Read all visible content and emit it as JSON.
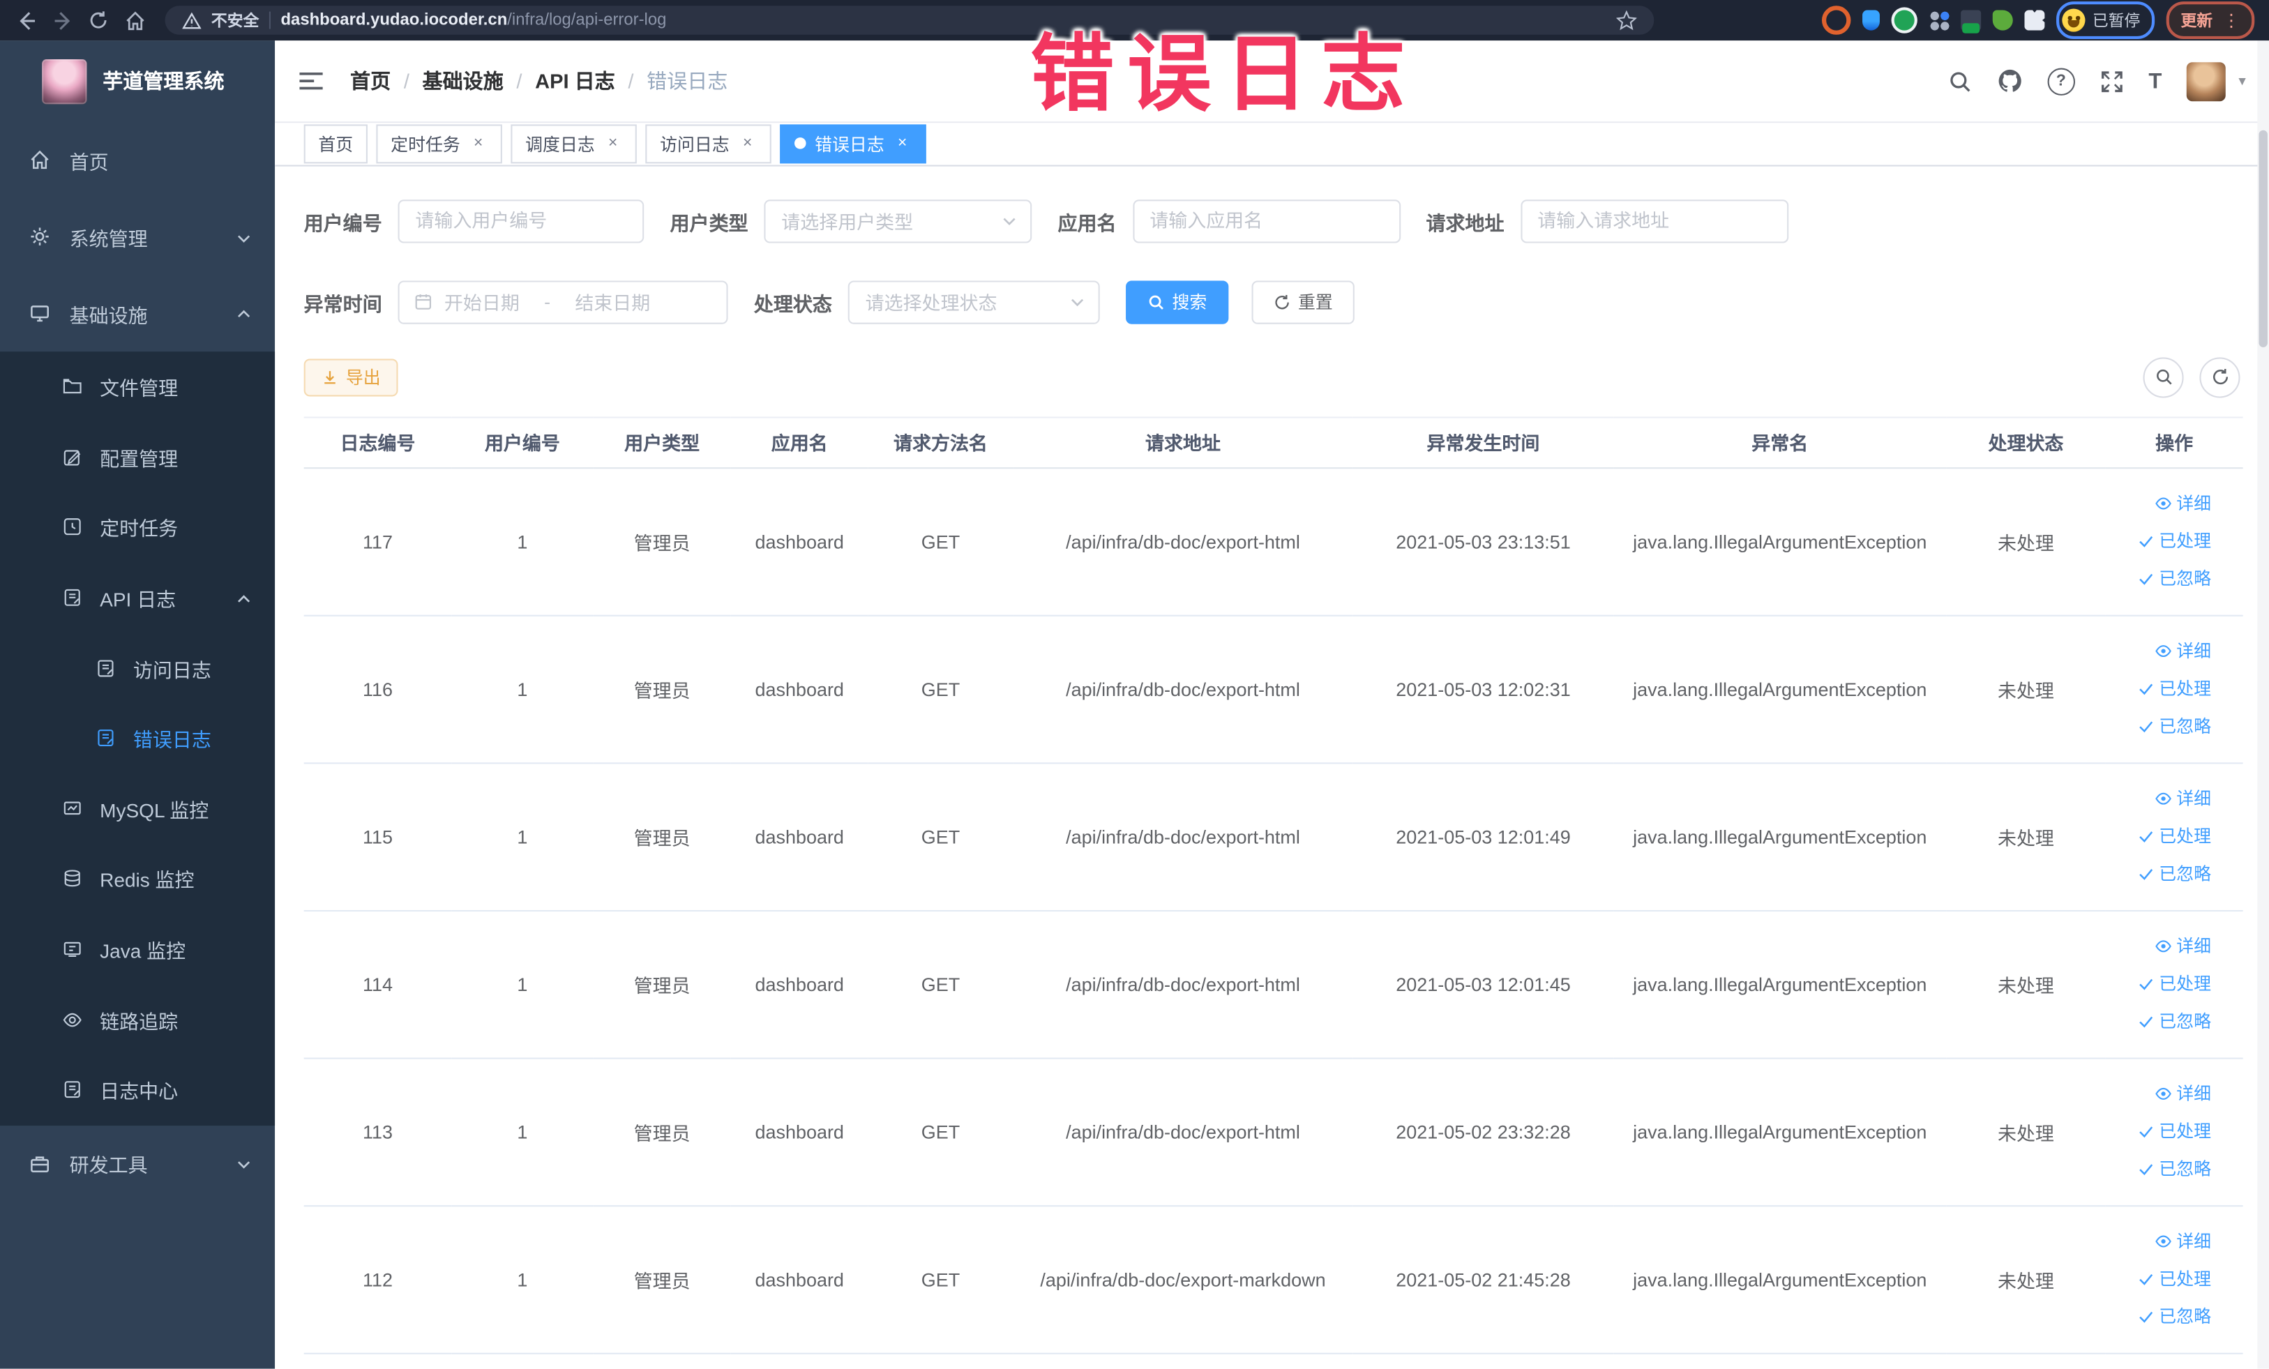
{
  "colors": {
    "accent": "#409eff",
    "warning_button": "#e6a23c",
    "annotation_red": "#f2365f",
    "sidebar_bg": "#304156",
    "submenu_bg": "#1f2d3d"
  },
  "annotation": {
    "text": "错误日志"
  },
  "browser": {
    "security_label": "不安全",
    "url_domain": "dashboard.yudao.iocoder.cn",
    "url_path": "/infra/log/api-error-log",
    "paused_badge": "已暂停",
    "update_button": "更新"
  },
  "icons": {
    "close": "×",
    "caret_down": "▾",
    "kebab": "⋮",
    "breadcrumb_sep": "/",
    "question": "?",
    "text_size": "T"
  },
  "sidebar": {
    "app_title": "芋道管理系统",
    "items": [
      {
        "label": "首页"
      },
      {
        "label": "系统管理"
      },
      {
        "label": "基础设施"
      },
      {
        "label": "文件管理"
      },
      {
        "label": "配置管理"
      },
      {
        "label": "定时任务"
      },
      {
        "label": "API 日志"
      },
      {
        "label": "访问日志"
      },
      {
        "label": "错误日志"
      },
      {
        "label": "MySQL 监控"
      },
      {
        "label": "Redis 监控"
      },
      {
        "label": "Java 监控"
      },
      {
        "label": "链路追踪"
      },
      {
        "label": "日志中心"
      },
      {
        "label": "研发工具"
      }
    ]
  },
  "breadcrumb": {
    "items": [
      "首页",
      "基础设施",
      "API 日志",
      "错误日志"
    ]
  },
  "tabs": [
    {
      "label": "首页"
    },
    {
      "label": "定时任务"
    },
    {
      "label": "调度日志"
    },
    {
      "label": "访问日志"
    },
    {
      "label": "错误日志"
    }
  ],
  "filters": {
    "user_id_label": "用户编号",
    "user_id_placeholder": "请输入用户编号",
    "user_type_label": "用户类型",
    "user_type_placeholder": "请选择用户类型",
    "app_name_label": "应用名",
    "app_name_placeholder": "请输入应用名",
    "request_url_label": "请求地址",
    "request_url_placeholder": "请输入请求地址",
    "exception_time_label": "异常时间",
    "start_date_placeholder": "开始日期",
    "end_date_placeholder": "结束日期",
    "date_separator": "-",
    "process_status_label": "处理状态",
    "process_status_placeholder": "请选择处理状态",
    "search_button": "搜索",
    "reset_button": "重置"
  },
  "toolbar": {
    "export_button": "导出"
  },
  "table": {
    "columns": [
      "日志编号",
      "用户编号",
      "用户类型",
      "应用名",
      "请求方法名",
      "请求地址",
      "异常发生时间",
      "异常名",
      "处理状态",
      "操作"
    ],
    "actions": {
      "detail": "详细",
      "processed": "已处理",
      "ignored": "已忽略"
    },
    "rows": [
      {
        "id": "117",
        "user_id": "1",
        "user_type": "管理员",
        "app": "dashboard",
        "method": "GET",
        "url": "/api/infra/db-doc/export-html",
        "time": "2021-05-03 23:13:51",
        "exception": "java.lang.IllegalArgumentException",
        "status": "未处理"
      },
      {
        "id": "116",
        "user_id": "1",
        "user_type": "管理员",
        "app": "dashboard",
        "method": "GET",
        "url": "/api/infra/db-doc/export-html",
        "time": "2021-05-03 12:02:31",
        "exception": "java.lang.IllegalArgumentException",
        "status": "未处理"
      },
      {
        "id": "115",
        "user_id": "1",
        "user_type": "管理员",
        "app": "dashboard",
        "method": "GET",
        "url": "/api/infra/db-doc/export-html",
        "time": "2021-05-03 12:01:49",
        "exception": "java.lang.IllegalArgumentException",
        "status": "未处理"
      },
      {
        "id": "114",
        "user_id": "1",
        "user_type": "管理员",
        "app": "dashboard",
        "method": "GET",
        "url": "/api/infra/db-doc/export-html",
        "time": "2021-05-03 12:01:45",
        "exception": "java.lang.IllegalArgumentException",
        "status": "未处理"
      },
      {
        "id": "113",
        "user_id": "1",
        "user_type": "管理员",
        "app": "dashboard",
        "method": "GET",
        "url": "/api/infra/db-doc/export-html",
        "time": "2021-05-02 23:32:28",
        "exception": "java.lang.IllegalArgumentException",
        "status": "未处理"
      },
      {
        "id": "112",
        "user_id": "1",
        "user_type": "管理员",
        "app": "dashboard",
        "method": "GET",
        "url": "/api/infra/db-doc/export-markdown",
        "time": "2021-05-02 21:45:28",
        "exception": "java.lang.IllegalArgumentException",
        "status": "未处理"
      }
    ]
  }
}
